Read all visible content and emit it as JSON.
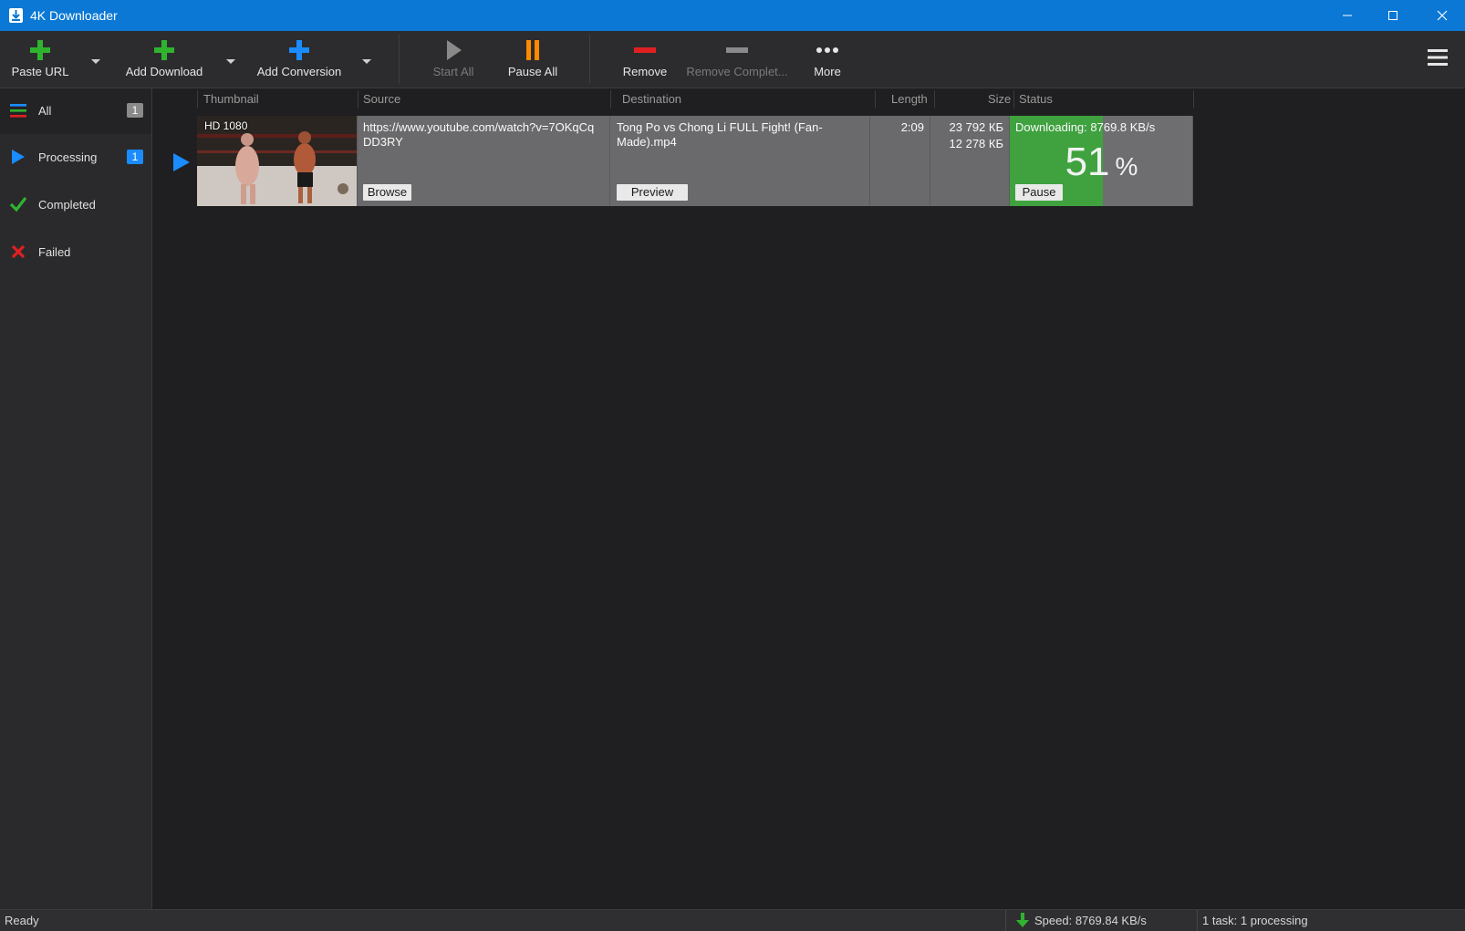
{
  "window": {
    "title": "4K Downloader",
    "accent": "#0a78d4"
  },
  "toolbar": {
    "paste_url": "Paste URL",
    "add_download": "Add Download",
    "add_conversion": "Add Conversion",
    "start_all": "Start All",
    "pause_all": "Pause All",
    "remove": "Remove",
    "remove_completed": "Remove Complet...",
    "more": "More"
  },
  "sidebar": {
    "items": [
      {
        "label": "All",
        "badge": "1",
        "icon": "list-icon"
      },
      {
        "label": "Processing",
        "badge": "1",
        "icon": "play-icon"
      },
      {
        "label": "Completed",
        "badge": "",
        "icon": "check-icon"
      },
      {
        "label": "Failed",
        "badge": "",
        "icon": "x-icon"
      }
    ]
  },
  "table": {
    "columns": [
      "Thumbnail",
      "Source",
      "Destination",
      "Length",
      "Size",
      "Status"
    ],
    "rows": [
      {
        "thumbnail_badge": "HD 1080",
        "source_url": "https://www.youtube.com/watch?v=7OKqCq DD3RY",
        "source_button": "Browse",
        "destination": "Tong Po vs Chong Li FULL Fight! (Fan-Made).mp4",
        "destination_button": "Preview",
        "length": "2:09",
        "size_total": "23 792 КБ",
        "size_done": "12 278 КБ",
        "status_text": "Downloading: 8769.8 KB/s",
        "progress_percent": "51",
        "progress_unit": "%",
        "progress_fraction": 0.51,
        "status_button": "Pause"
      }
    ]
  },
  "statusbar": {
    "state": "Ready",
    "speed": "Speed: 8769.84 KB/s",
    "tasks": "1 task: 1 processing"
  },
  "colors": {
    "green": "#2fb32f",
    "blue": "#1a8cff",
    "orange": "#ff8a00",
    "red": "#e02020",
    "progress": "#3fa23f"
  }
}
